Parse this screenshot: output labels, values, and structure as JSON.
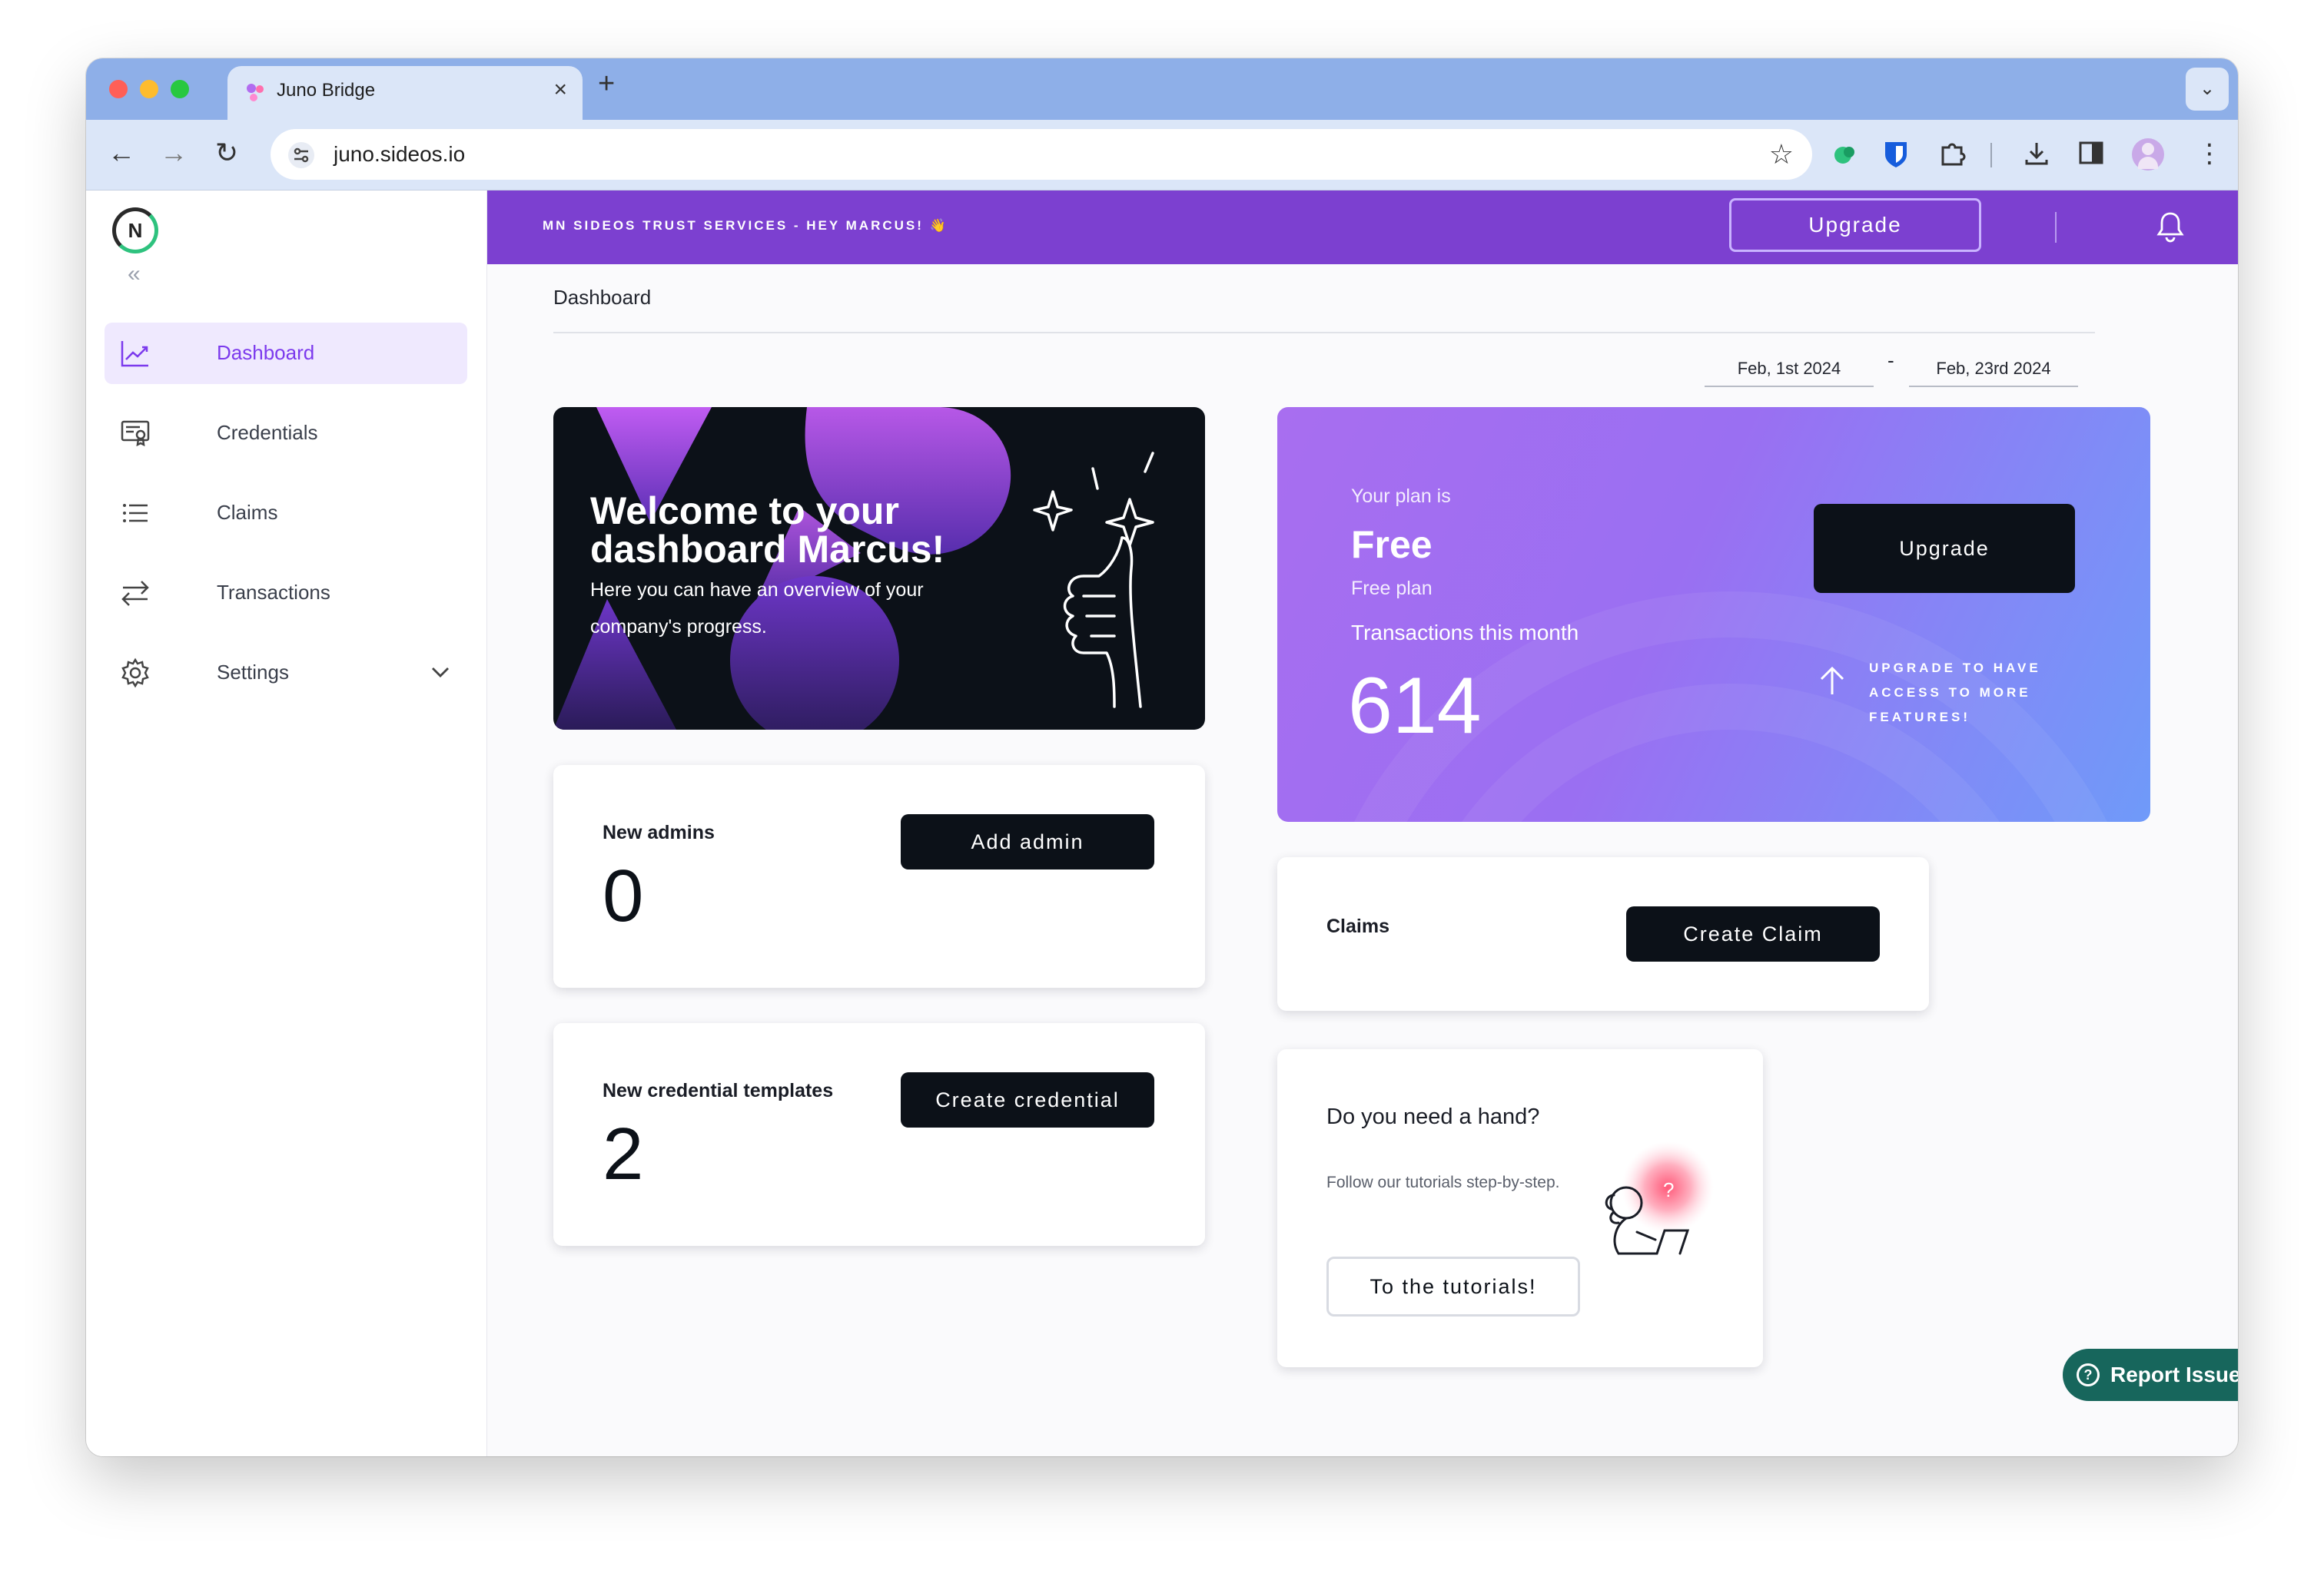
{
  "browser": {
    "tab_title": "Juno Bridge",
    "url": "juno.sideos.io",
    "tab_close": "×",
    "new_tab": "+",
    "tab_search": "⌄",
    "back": "←",
    "forward": "→",
    "reload": "↻",
    "bookmark": "☆",
    "menu": "⋮",
    "traffic_colors": [
      "#ff5f57",
      "#febc2e",
      "#28c840"
    ]
  },
  "sidebar": {
    "logo_text": "N",
    "collapse": "«",
    "items": [
      {
        "label": "Dashboard",
        "icon": "chart-line-icon"
      },
      {
        "label": "Credentials",
        "icon": "certificate-icon"
      },
      {
        "label": "Claims",
        "icon": "list-icon"
      },
      {
        "label": "Transactions",
        "icon": "arrows-swap-icon"
      },
      {
        "label": "Settings",
        "icon": "gear-icon",
        "chevron": "⌄"
      }
    ]
  },
  "topbar": {
    "message": "MN SIDEOS TRUST SERVICES - HEY MARCUS! 👋",
    "upgrade_label": "Upgrade",
    "accent": "#7c40d0"
  },
  "main": {
    "breadcrumb": "Dashboard",
    "date_from": "Feb, 1st 2024",
    "date_sep": "-",
    "date_to": "Feb, 23rd 2024",
    "welcome": {
      "title": "Welcome to your dashboard Marcus!",
      "subtitle": "Here you can have an overview of your company's progress."
    },
    "admins": {
      "label": "New admins",
      "value": "0",
      "button": "Add admin"
    },
    "credentials": {
      "label": "New credential templates",
      "value": "2",
      "button": "Create credential"
    },
    "plan": {
      "intro": "Your plan is",
      "name": "Free",
      "plan_sub": "Free plan",
      "tx_label": "Transactions this month",
      "tx_value": "614",
      "button": "Upgrade",
      "upsell": "UPGRADE TO HAVE ACCESS TO MORE FEATURES!"
    },
    "claims": {
      "label": "Claims",
      "button": "Create Claim"
    },
    "help": {
      "title": "Do you need a hand?",
      "text": "Follow our tutorials step-by-step.",
      "button": "To the tutorials!"
    },
    "report": {
      "label": "Report Issue",
      "icon": "?"
    }
  }
}
